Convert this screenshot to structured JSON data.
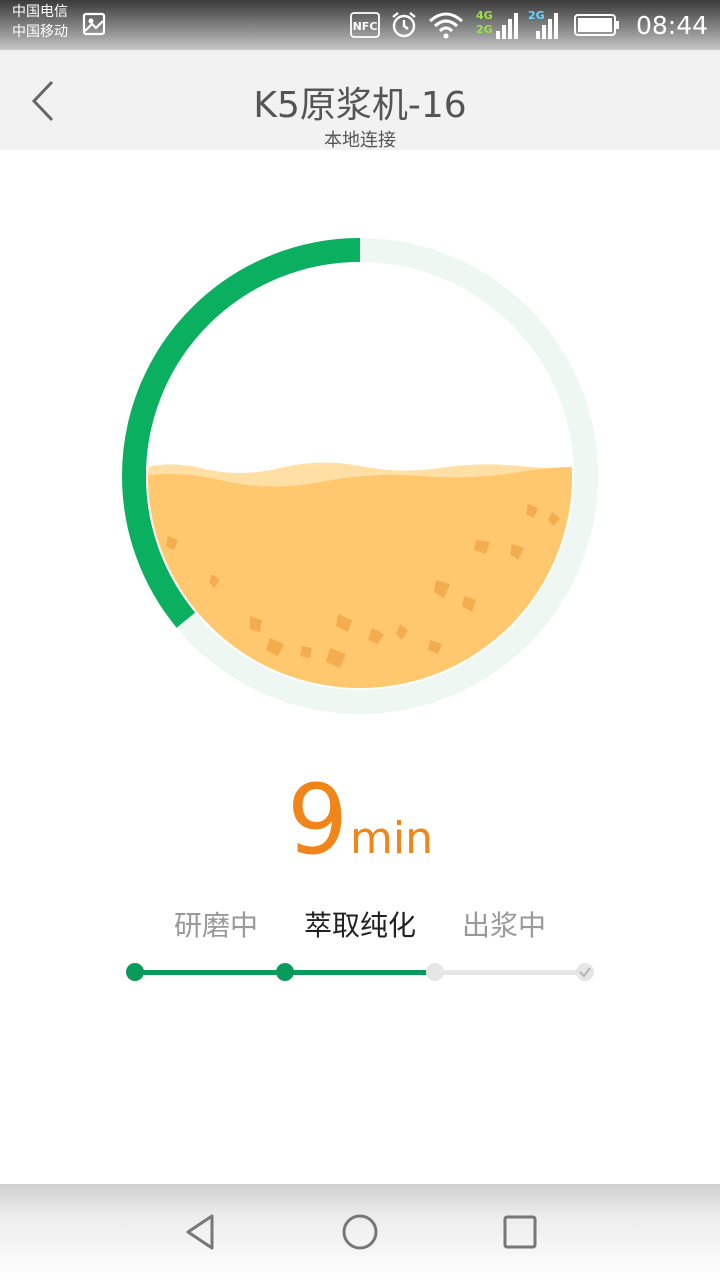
{
  "status_bar": {
    "carrier_1": "中国电信",
    "carrier_2": "中国移动",
    "nfc": "NFC",
    "net_1": "4G",
    "net_1_sub": "2G",
    "net_2": "2G",
    "time": "08:44",
    "icons": [
      "gallery-icon",
      "nfc-icon",
      "alarm-icon",
      "wifi-icon",
      "signal-icon",
      "battery-icon"
    ]
  },
  "header": {
    "title": "K5原浆机-16",
    "subtitle": "本地连接",
    "back_icon": "chevron-left-icon"
  },
  "progress": {
    "ring_fraction": 0.36,
    "liquid_level": 0.52,
    "colors": {
      "ring": "#0aaf60",
      "ring_track": "#eef7f2",
      "liquid": "#ffc86e",
      "wave": "#ffdfa3",
      "grain": "#f3ad4f"
    }
  },
  "timer": {
    "value": "9",
    "unit": "min",
    "color": "#f08519"
  },
  "steps": [
    {
      "label": "研磨中",
      "state": "done"
    },
    {
      "label": "萃取纯化",
      "state": "active"
    },
    {
      "label": "出浆中",
      "state": "pending"
    }
  ],
  "step_colors": {
    "done": "#0a9a5c",
    "pending": "#e6e6e6"
  },
  "navbar": {
    "icons": [
      "back-triangle-icon",
      "home-circle-icon",
      "recents-square-icon"
    ]
  }
}
